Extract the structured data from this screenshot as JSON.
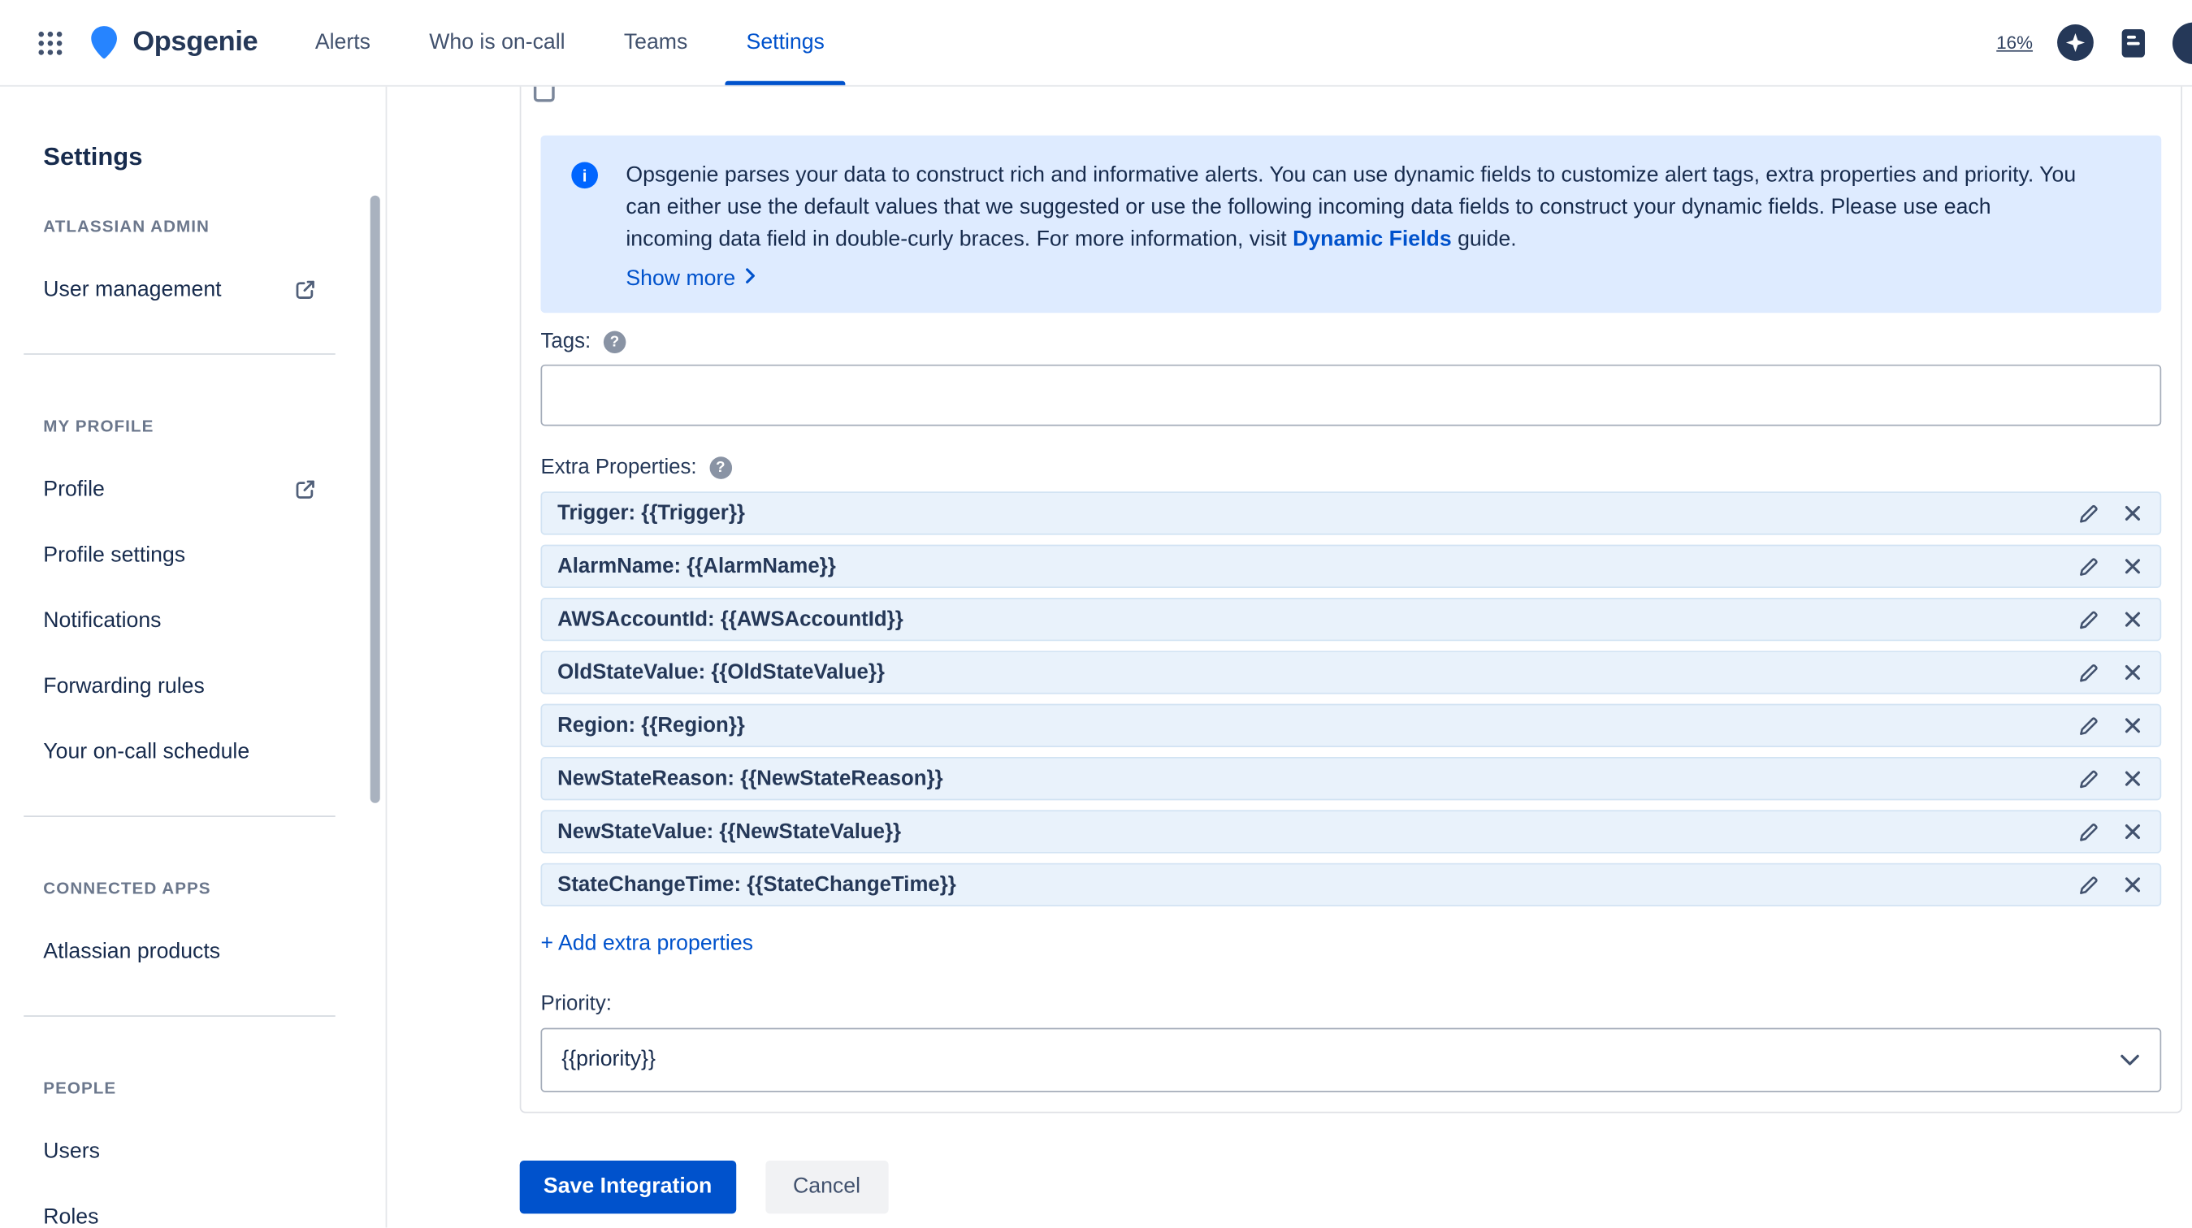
{
  "icons": {
    "info": "i",
    "help": "?"
  },
  "colors": {
    "accent": "#0052CC",
    "link": "#0065FF",
    "info_banner_bg": "#DEEBFF",
    "property_row_bg": "#E9F2FB",
    "text": "#172B4D"
  },
  "topnav": {
    "brand": "Opsgenie",
    "items": [
      {
        "label": "Alerts"
      },
      {
        "label": "Who is on-call"
      },
      {
        "label": "Teams"
      },
      {
        "label": "Settings"
      }
    ],
    "zoom_level": "16%"
  },
  "sidebar": {
    "title": "Settings",
    "sections": [
      {
        "label": "ATLASSIAN ADMIN",
        "items": [
          {
            "label": "User management",
            "external": true
          }
        ]
      },
      {
        "label": "MY PROFILE",
        "items": [
          {
            "label": "Profile",
            "external": true
          },
          {
            "label": "Profile settings"
          },
          {
            "label": "Notifications"
          },
          {
            "label": "Forwarding rules"
          },
          {
            "label": "Your on-call schedule"
          }
        ]
      },
      {
        "label": "CONNECTED APPS",
        "items": [
          {
            "label": "Atlassian products"
          }
        ]
      },
      {
        "label": "PEOPLE",
        "items": [
          {
            "label": "Users"
          },
          {
            "label": "Roles"
          }
        ]
      }
    ]
  },
  "form": {
    "info_banner": {
      "text_before_link": "Opsgenie parses your data to construct rich and informative alerts. You can use dynamic fields to customize alert tags, extra properties and priority. You can either use the default values that we suggested or use the following incoming data fields to construct your dynamic fields. Please use each incoming data field in double-curly braces. For more information, visit",
      "link_label": "Dynamic Fields",
      "text_after_link": "guide.",
      "show_more_label": "Show more"
    },
    "tags": {
      "label": "Tags:",
      "value": ""
    },
    "extra_properties": {
      "label": "Extra Properties:",
      "rows": [
        {
          "value": "Trigger: {{Trigger}}"
        },
        {
          "value": "AlarmName: {{AlarmName}}"
        },
        {
          "value": "AWSAccountId: {{AWSAccountId}}"
        },
        {
          "value": "OldStateValue: {{OldStateValue}}"
        },
        {
          "value": "Region: {{Region}}"
        },
        {
          "value": "NewStateReason: {{NewStateReason}}"
        },
        {
          "value": "NewStateValue: {{NewStateValue}}"
        },
        {
          "value": "StateChangeTime: {{StateChangeTime}}"
        }
      ],
      "add_label": "+ Add extra properties"
    },
    "priority": {
      "label": "Priority:",
      "value": "{{priority}}"
    },
    "buttons": {
      "save": "Save Integration",
      "cancel": "Cancel"
    }
  }
}
